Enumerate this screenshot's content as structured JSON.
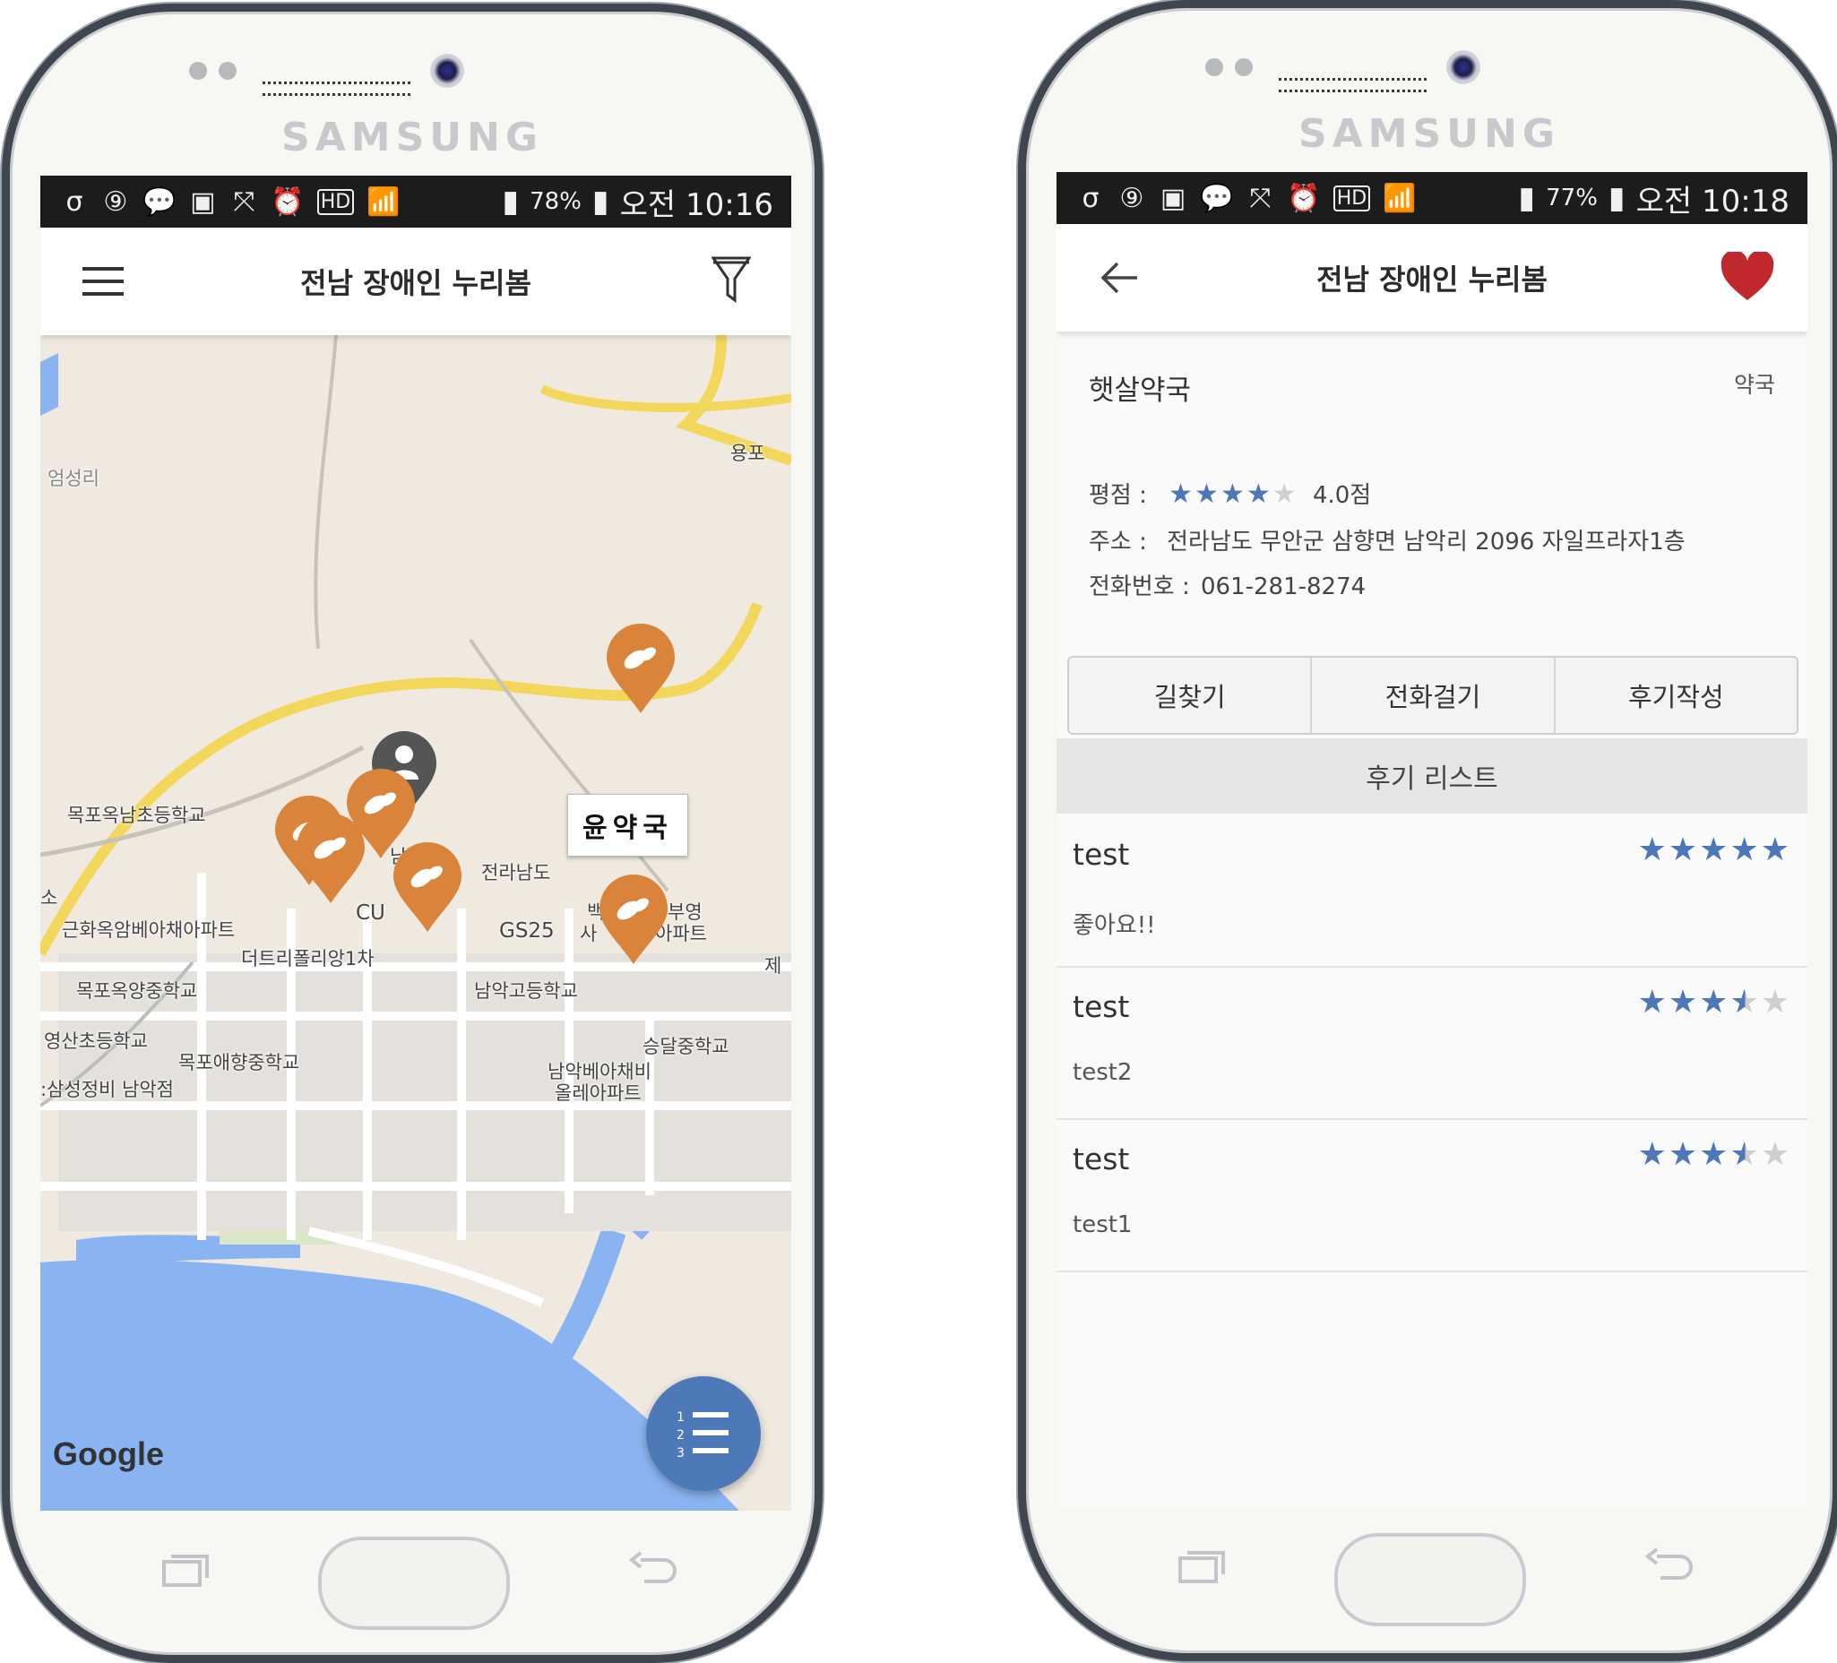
{
  "phones": [
    {
      "brand": "SAMSUNG",
      "status": {
        "left_icons": [
          "σ",
          "⑨",
          "💬",
          "▣",
          "⤧",
          "⏰",
          "HD",
          "📶"
        ],
        "battery_pct": "78%",
        "time": "오전 10:16"
      },
      "appbar": {
        "title": "전남 장애인 누리봄",
        "left_icon": "hamburger-menu-icon",
        "right_icon": "filter-funnel-icon"
      },
      "map": {
        "labels": {
          "yongpo": "용포",
          "eomseongri": "엄성리",
          "mokpo_oknam_elem": "목포옥남초등학교",
          "namdo_cheong": "남도청",
          "jeonnamdo": "전라남도",
          "cu": "CU",
          "gs25": "GS25",
          "geunhwa_apt": "근화옥암베아채아파트",
          "the_tree": "더트리폴리앙1차",
          "mokpo_okyang_mid": "목포옥양중학교",
          "namak_high": "남악고등학교",
          "yeongsan_elem": "영산초등학교",
          "mokpo_aehyang_mid": "목포애향중학교",
          "samsung_namak": ":삼성정비 남악점",
          "seungdal_mid": "승달중학교",
          "namak_beachaebi": "남악베아채비",
          "olle_apt": "올레아파트",
          "buyoung_apt": "부영",
          "buyoung_apt2": "아파트",
          "baek": "백",
          "sa": "사",
          "je": "제",
          "so": "소"
        },
        "callout": "윤약국",
        "attribution": "Google",
        "fab_icon": "numbered-list-icon"
      },
      "navbar": [
        "recent-apps-icon",
        "home-button",
        "back-icon"
      ]
    },
    {
      "brand": "SAMSUNG",
      "status": {
        "left_icons": [
          "σ",
          "⑨",
          "▣",
          "💬",
          "⤧",
          "⏰",
          "HD",
          "📶"
        ],
        "battery_pct": "77%",
        "time": "오전 10:18"
      },
      "appbar": {
        "title": "전남 장애인 누리봄",
        "left_icon": "back-arrow-icon",
        "right_icon": "heart-icon"
      },
      "detail": {
        "name": "햇살약국",
        "category": "약국",
        "rating_label": "평점 :",
        "rating_value": 4.0,
        "rating_text": "4.0점",
        "address_label": "주소 :",
        "address": "전라남도 무안군 삼향면 남악리 2096  자일프라자1층",
        "phone_label": "전화번호 :",
        "phone": "061-281-8274",
        "buttons": [
          "길찾기",
          "전화걸기",
          "후기작성"
        ],
        "reviews_header": "후기 리스트",
        "reviews": [
          {
            "user": "test",
            "rating": 5,
            "text": "좋아요!!"
          },
          {
            "user": "test",
            "rating": 3.5,
            "text": "test2"
          },
          {
            "user": "test",
            "rating": 3.5,
            "text": "test1"
          }
        ]
      },
      "navbar": [
        "recent-apps-icon",
        "home-button",
        "back-icon"
      ]
    }
  ],
  "colors": {
    "marker_orange": "#d9843a",
    "user_marker_gray": "#555555",
    "fab_blue": "#4d79b9",
    "star_blue": "#4d77b8",
    "heart_red": "#c0282e",
    "road_yellow": "#f2d75b",
    "water_blue": "#8ab4f1"
  }
}
